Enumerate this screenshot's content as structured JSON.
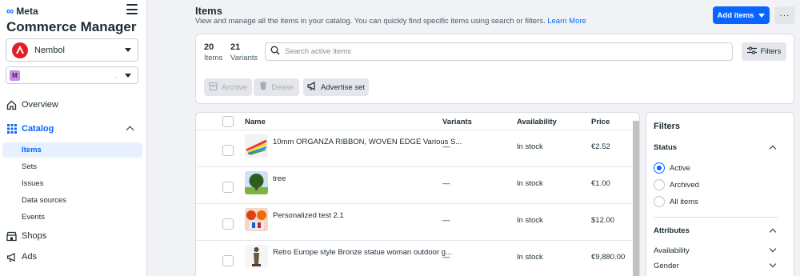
{
  "brand": {
    "logo_text": "Meta",
    "app_title": "Commerce Manager"
  },
  "business": {
    "name": "Nembol"
  },
  "catalog_selector": {
    "badge": "M",
    "dots": "."
  },
  "nav": {
    "overview": "Overview",
    "catalog": "Catalog",
    "catalog_sub": [
      "Items",
      "Sets",
      "Issues",
      "Data sources",
      "Events"
    ],
    "shops": "Shops",
    "ads": "Ads"
  },
  "header": {
    "title": "Items",
    "subtitle": "View and manage all the items in your catalog. You can quickly find specific items using search or filters.",
    "learn_more": "Learn More",
    "add_items": "Add items",
    "more": "···"
  },
  "summary": {
    "items_count": "20",
    "items_label": "Items",
    "variants_count": "21",
    "variants_label": "Variants"
  },
  "search": {
    "placeholder": "Search active items"
  },
  "filters_button": "Filters",
  "toolbar": {
    "archive": "Archive",
    "delete": "Delete",
    "advertise": "Advertise set"
  },
  "table": {
    "columns": [
      "Name",
      "Variants",
      "Availability",
      "Price"
    ],
    "rows": [
      {
        "name": "10mm ORGANZA RIBBON, WOVEN EDGE Various S...",
        "variants": "—",
        "availability": "In stock",
        "price": "€2.52"
      },
      {
        "name": "tree",
        "variants": "—",
        "availability": "In stock",
        "price": "€1.00"
      },
      {
        "name": "Personalized test 2.1",
        "variants": "—",
        "availability": "In stock",
        "price": "$12.00"
      },
      {
        "name": "Retro Europe style Bronze statue woman outdoor g...",
        "variants": "—",
        "availability": "In stock",
        "price": "€9,880.00"
      }
    ]
  },
  "filter_panel": {
    "title": "Filters",
    "status_title": "Status",
    "status_options": [
      "Active",
      "Archived",
      "All items"
    ],
    "status_selected": "Active",
    "attributes_title": "Attributes",
    "attributes": [
      "Availability",
      "Gender"
    ]
  },
  "colors": {
    "accent": "#0866ff",
    "sidebar_active_bg": "#e7f0ff",
    "business_logo": "#e41e26"
  }
}
